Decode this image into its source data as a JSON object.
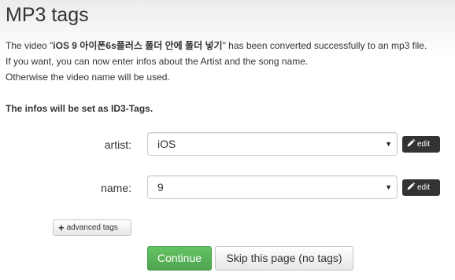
{
  "page": {
    "title": "MP3 tags"
  },
  "intro": {
    "line1_prefix": "The video \"",
    "video_name": "iOS 9 아이폰6s플러스 폴더 안에 폴더 넣기",
    "line1_suffix": "\" has been converted successfully to an mp3 file.",
    "line2": "If you want, you can now enter infos about the Artist and the song name.",
    "line3": "Otherwise the video name will be used."
  },
  "id3_note": "The infos will be set as ID3-Tags.",
  "fields": {
    "artist": {
      "label": "artist:",
      "value": "iOS",
      "edit_label": "edit"
    },
    "name": {
      "label": "name:",
      "value": "9",
      "edit_label": "edit"
    }
  },
  "icons": {
    "dropdown": "chevron-down-icon",
    "edit": "pencil-icon",
    "advanced": "plus-icon"
  },
  "buttons": {
    "advanced_tags": "advanced tags",
    "continue": "Continue",
    "skip": "Skip this page (no tags)"
  },
  "colors": {
    "continue_bg": "#5cb85c",
    "edit_bg": "#333333",
    "header_bg": "#ececec"
  }
}
